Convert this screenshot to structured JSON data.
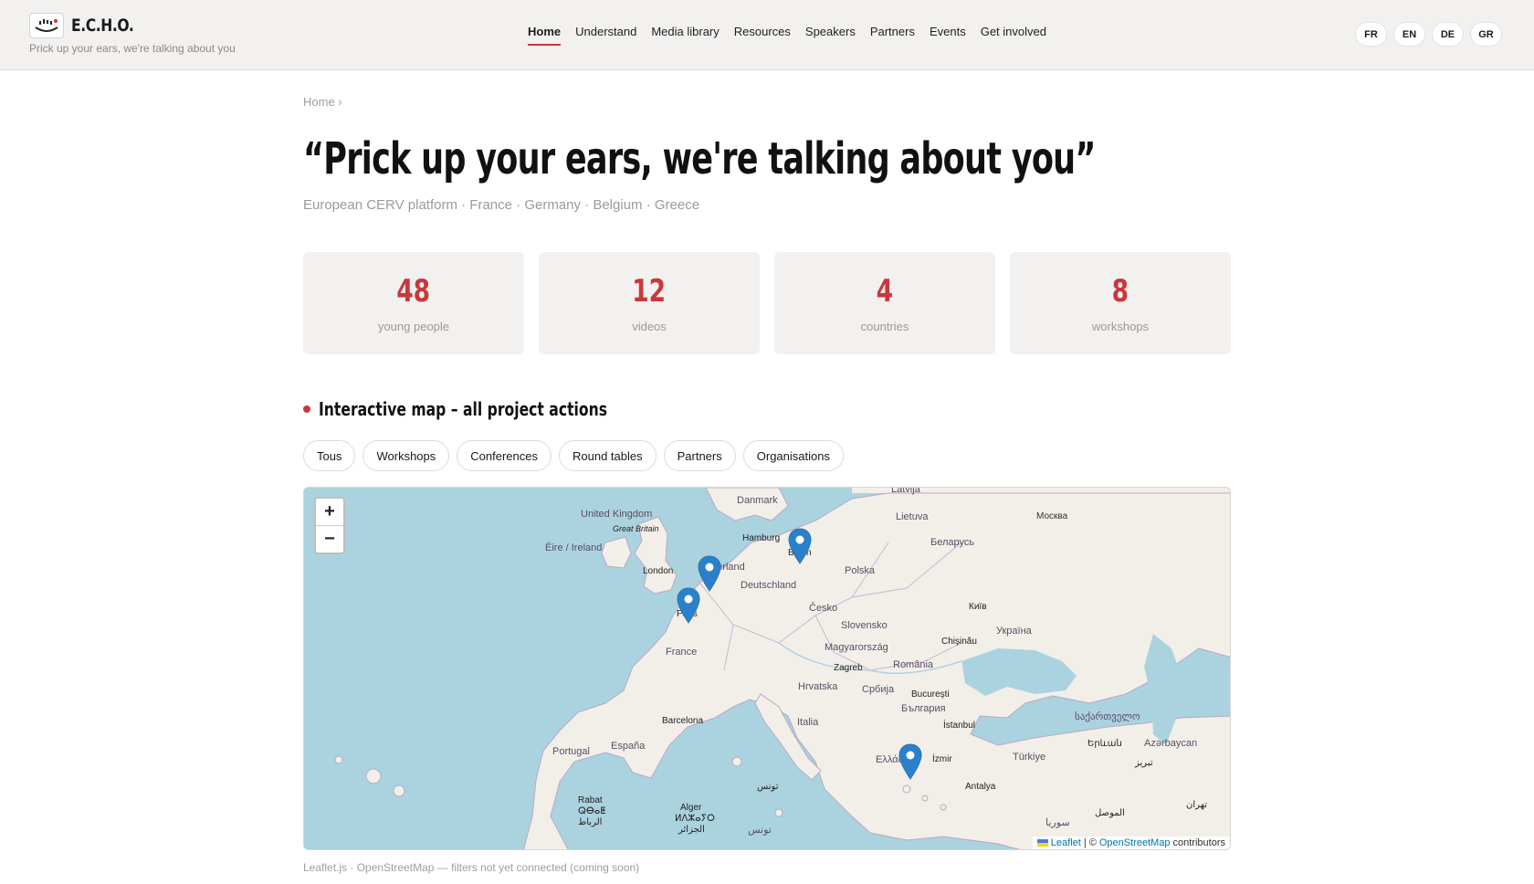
{
  "header": {
    "logo_text": "E.C.H.O.",
    "tagline": "Prick up your ears, we're talking about you",
    "nav": [
      {
        "label": "Home",
        "active": true
      },
      {
        "label": "Understand"
      },
      {
        "label": "Media library"
      },
      {
        "label": "Resources"
      },
      {
        "label": "Speakers"
      },
      {
        "label": "Partners"
      },
      {
        "label": "Events"
      },
      {
        "label": "Get involved"
      }
    ],
    "languages": [
      "FR",
      "EN",
      "DE",
      "GR"
    ]
  },
  "breadcrumb": "Home ›",
  "title": "“Prick up your ears, we're talking about you”",
  "subtitle": "European CERV platform · France · Germany · Belgium · Greece",
  "stats": [
    {
      "value": "48",
      "label": "young people"
    },
    {
      "value": "12",
      "label": "videos"
    },
    {
      "value": "4",
      "label": "countries"
    },
    {
      "value": "8",
      "label": "workshops"
    }
  ],
  "section_title": "Interactive map – all project actions",
  "filters": [
    "Tous",
    "Workshops",
    "Conferences",
    "Round tables",
    "Partners",
    "Organisations"
  ],
  "map": {
    "zoom_in": "+",
    "zoom_out": "−",
    "attribution": {
      "leaflet": "Leaflet",
      "sep": "| ©",
      "osm": "OpenStreetMap",
      "suffix": "contributors"
    },
    "labels": {
      "latvija": "Latvija",
      "danmark": "Danmark",
      "moskva": "Москва",
      "uk": "United Kingdom",
      "great_britain": "Great Britain",
      "lietuva": "Lietuva",
      "hamburg": "Hamburg",
      "belarus": "Беларусь",
      "eire": "Éire / Ireland",
      "berlin": "Berlin",
      "nederland": "Nederland",
      "london": "London",
      "polska": "Polska",
      "deutschland": "Deutschland",
      "kyiv": "Київ",
      "paris": "Paris",
      "cesko": "Česko",
      "slovensko": "Slovensko",
      "ukraina": "Україна",
      "chisinau": "Chișinău",
      "france": "France",
      "magyarorszag": "Magyarország",
      "zagreb": "Zagreb",
      "romania": "România",
      "hrvatska": "Hrvatska",
      "srbija": "Србија",
      "bucuresti": "București",
      "bulgaria": "България",
      "barcelona": "Barcelona",
      "italia": "Italia",
      "istanbul": "İstanbul",
      "georgia": "საქართველო",
      "portugal": "Portugal",
      "espana": "España",
      "yerevan": "Երևան",
      "azerbaycan": "Azərbaycan",
      "ellada": "Ελλάδα",
      "izmir": "İzmir",
      "turkiye": "Türkiye",
      "tunis": "تونس",
      "tabriz": "تبریز",
      "rabat": "Rabat",
      "rabat_tif": "ⵕⴱⴰⵟ",
      "rabat_ar": "الرباط",
      "antalya": "Antalya",
      "alger": "Alger",
      "alger_tif": "ⵍⴷⵣⴰⵢⵔ",
      "alger_ar": "الجزائر",
      "mosul": "الموصل",
      "tehran": "تهران",
      "tunisia": "تونس",
      "suriya": "سوريا"
    }
  },
  "footnote": "Leaflet.js · OpenStreetMap — filters not yet connected (coming soon)"
}
